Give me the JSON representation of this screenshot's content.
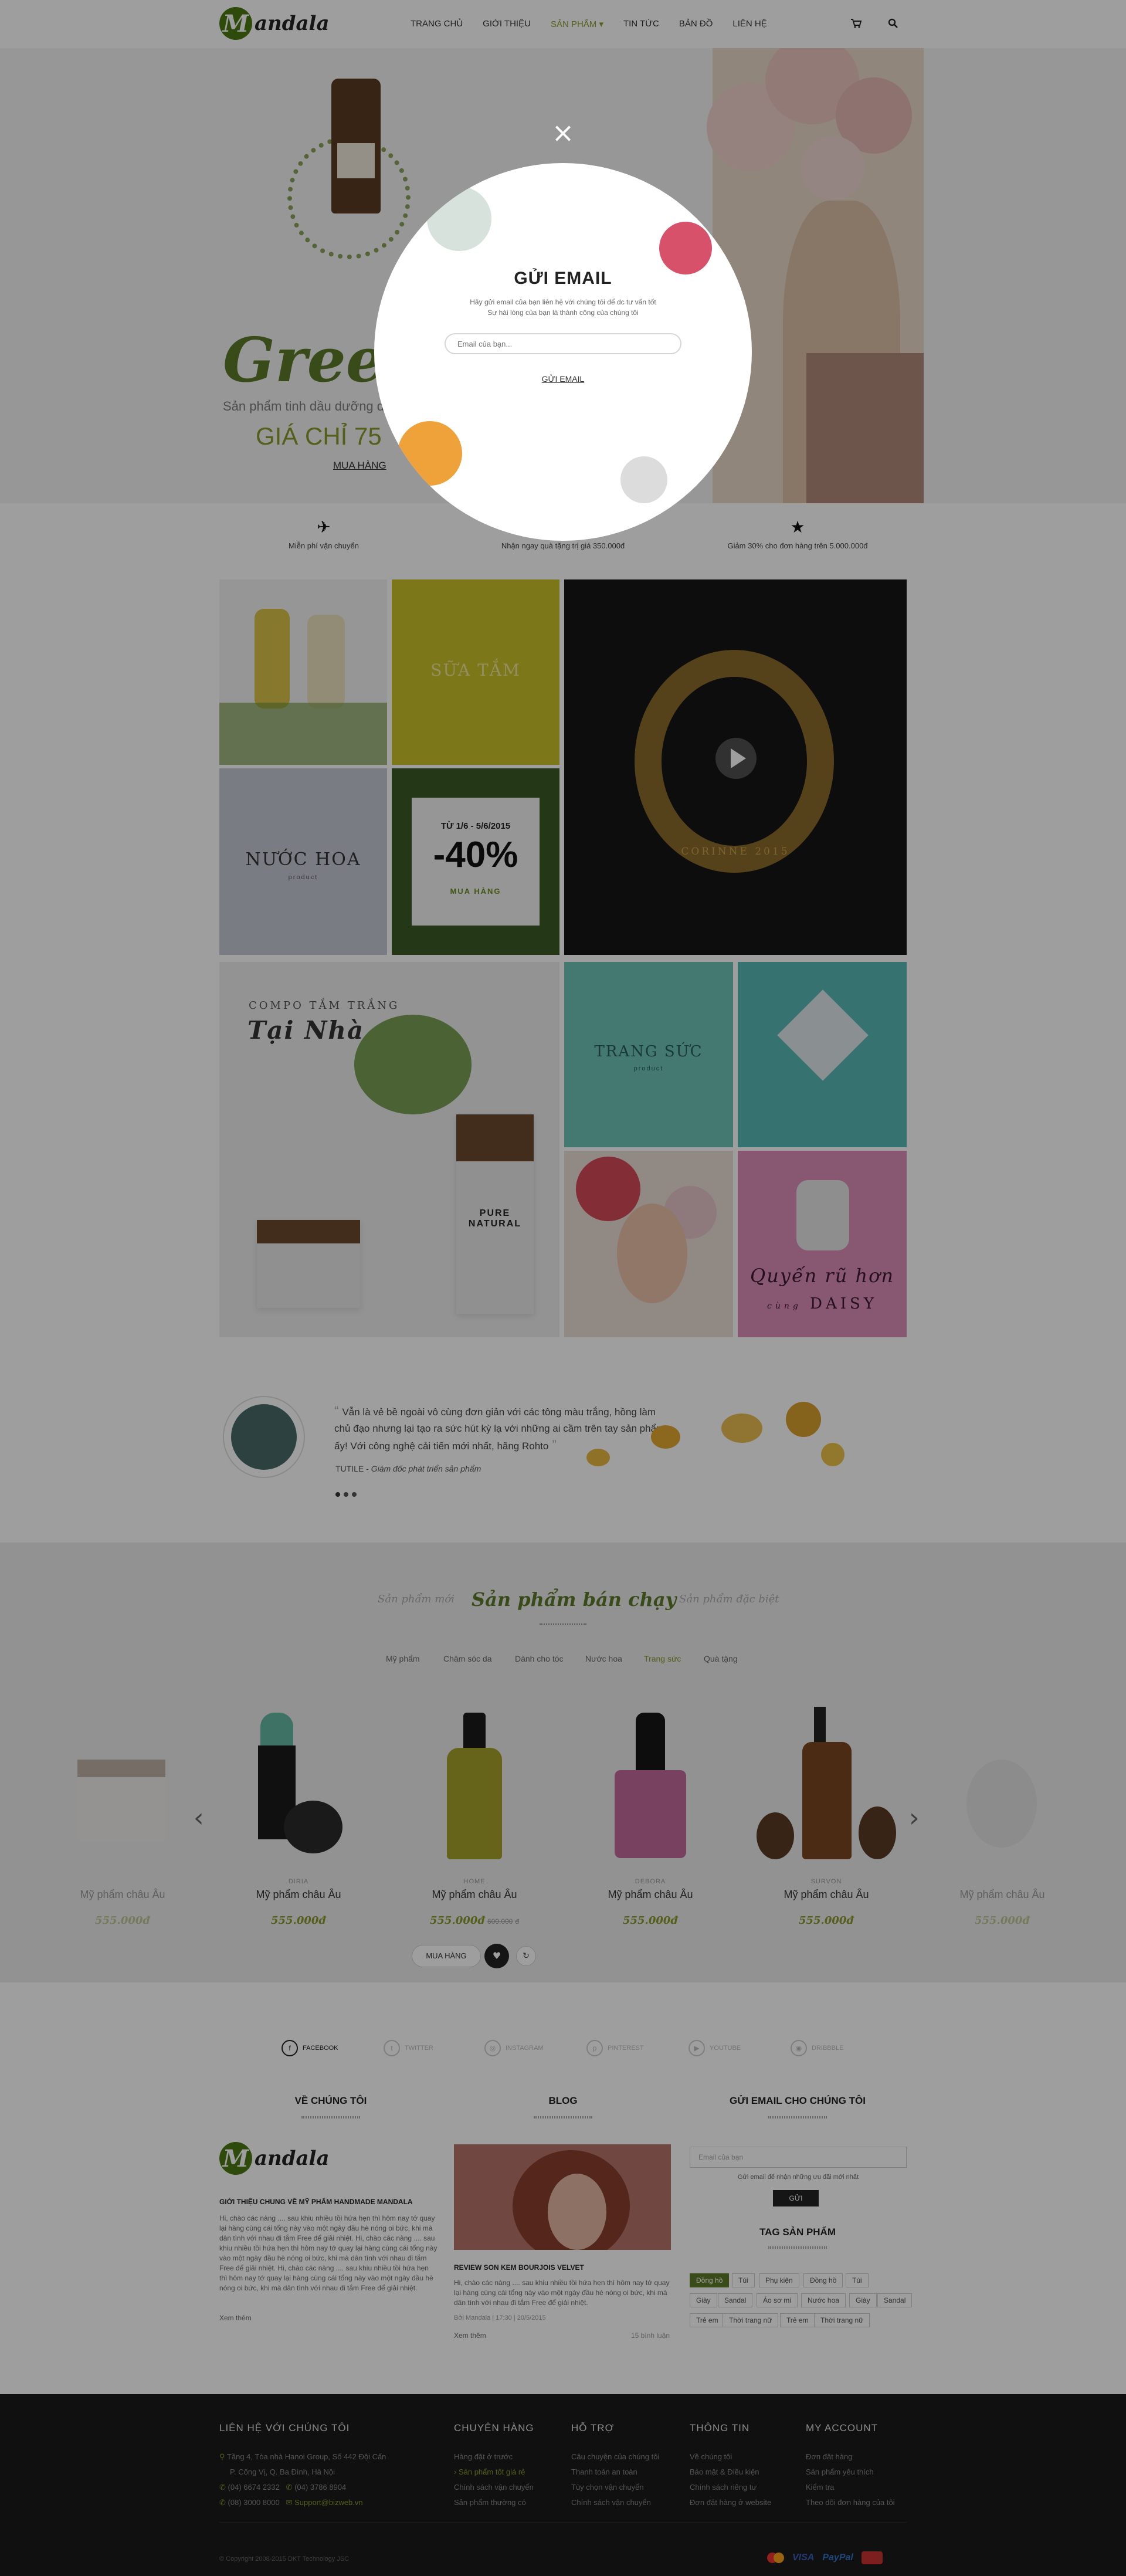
{
  "header": {
    "logo_letter": "M",
    "logo_text": "andala",
    "nav": [
      "TRANG CHỦ",
      "GIỚI THIỆU",
      "SẢN PHẨM",
      "TIN TỨC",
      "BẢN ĐỒ",
      "LIÊN HỆ"
    ],
    "nav_active_index": 2,
    "cart_icon": "cart-icon",
    "search_icon": "search-icon"
  },
  "hero": {
    "title": "Green",
    "subtitle": "Sản phẩm tinh dầu dưỡng da",
    "price": "GIÁ CHỈ 75",
    "cta": "MUA HÀNG"
  },
  "modal": {
    "close": "×",
    "title": "GỬI EMAIL",
    "desc_line1": "Hãy gửi email của bạn liên hệ với chúng tôi để dc tư vấn tốt",
    "desc_line2": "Sự hài lòng của bạn là thành công của chúng tôi",
    "input_placeholder": "Email của bạn...",
    "button": "GỬI EMAIL"
  },
  "features": [
    {
      "icon": "plane-icon",
      "text": "Miễn phí vận chuyển"
    },
    {
      "icon": "gift-icon",
      "text": "Nhận ngay quà tặng trị giá 350.000đ"
    },
    {
      "icon": "star-icon",
      "text": "Giảm 30% cho đơn hàng trên 5.000.000đ"
    }
  ],
  "grid": {
    "sua_tam": "SỮA TẮM",
    "nuoc_hoa": "NƯỚC HOA",
    "nuoc_hoa_sub": "product",
    "promo_date": "TỪ 1/6 - 5/6/2015",
    "promo_pct": "-40%",
    "promo_cta": "MUA HÀNG",
    "bracelet": "CORINNE 2015",
    "combo_line1": "COMPO TẮM TRẮNG",
    "combo_line2": "Tại Nhà",
    "pure_natural": "PURE NATURAL",
    "trang_suc": "TRANG SỨC",
    "trang_suc_sub": "product",
    "quyen_ru_1": "Quyến rũ hơn",
    "quyen_ru_2": "cùng",
    "quyen_ru_3": "DAISY"
  },
  "testimonial": {
    "quote": "Vẫn là vẻ bề ngoài vô cùng đơn giản với các tông màu trắng, hồng làm chủ đạo nhưng lại tạo ra sức hút kỳ lạ với những ai cầm trên tay sản phẩm ấy! Với công nghệ cải tiến mới nhất, hãng Rohto",
    "author": "TUTILE",
    "role": "Giám đốc phát triển sản phẩm"
  },
  "products_section": {
    "tabs": [
      "Sản phẩm mới",
      "Sản phẩm bán chạy",
      "Sản phẩm đặc biệt"
    ],
    "active_tab": 1,
    "categories": [
      "Mỹ phẩm",
      "Chăm sóc da",
      "Dành cho tóc",
      "Nước hoa",
      "Trang sức",
      "Quà tặng"
    ],
    "active_category": 4,
    "items": [
      {
        "brand": "",
        "name": "Mỹ phẩm châu Âu",
        "price": "555.000",
        "old": ""
      },
      {
        "brand": "DIRIA",
        "name": "Mỹ phẩm châu Âu",
        "price": "555.000",
        "old": ""
      },
      {
        "brand": "HOME",
        "name": "Mỹ phẩm châu Âu",
        "price": "555.000",
        "old": "600.000"
      },
      {
        "brand": "DEBORA",
        "name": "Mỹ phẩm châu Âu",
        "price": "555.000",
        "old": ""
      },
      {
        "brand": "SURVON",
        "name": "Mỹ phẩm châu Âu",
        "price": "555.000",
        "old": ""
      },
      {
        "brand": "",
        "name": "Mỹ phẩm châu Âu",
        "price": "555.000",
        "old": ""
      }
    ],
    "currency": "đ",
    "buy_button": "MUA HÀNG"
  },
  "social": [
    "FACEBOOK",
    "TWITTER",
    "INSTAGRAM",
    "PINTEREST",
    "YOUTUBE",
    "DRIBBBLE"
  ],
  "about": {
    "heading": "VỀ CHÚNG TÔI",
    "logo_letter": "M",
    "logo_text": "andala",
    "subtitle": "GIỚI THIỆU CHUNG VỀ MỸ PHẨM HANDMADE MANDALA",
    "body": "Hi, chào các nàng .... sau khiu nhiều tồi hứa hẹn thì hôm nay tớ quay lại hàng cùng cái tổng này vào một ngày đầu hè nóng oi bức, khi mà dân tình với nhau đi tắm Free để giải nhiệt. Hi, chào các nàng .... sau khiu nhiều tồi hứa hẹn thì hôm nay tớ quay lại hàng cùng cái tổng này vào một ngày đầu hè nóng oi bức, khi mà dân tình với nhau đi tắm Free để giải nhiệt. Hi, chào các nàng .... sau khiu nhiều tồi hứa hẹn thì hôm nay tớ quay lại hàng cùng cái tổng này vào một ngày đầu hè nóng oi bức, khi mà dân tình với nhau đi tắm Free để giải nhiệt.",
    "more": "Xem thêm"
  },
  "blog": {
    "heading": "BLOG",
    "post_title": "REVIEW SON KEM BOURJOIS VELVET",
    "excerpt": "Hi, chào các nàng .... sau khiu nhiều tồi hứa hẹn thì hôm nay tớ quay lại hàng cùng cái tổng này vào một ngày đầu hè nóng oi bức, khi mà dân tình với nhau đi tắm Free để giải nhiệt.",
    "meta": "Bởi Mandala | 17:30 | 20/5/2015",
    "more": "Xem thêm",
    "comments": "15 bình luận"
  },
  "newsletter": {
    "heading": "GỬI EMAIL CHO CHÚNG TÔI",
    "placeholder": "Email của bạn",
    "note": "Gửi email để nhận những ưu đãi mới nhất",
    "button": "GỬI"
  },
  "tags": {
    "heading": "TAG SẢN PHẨM",
    "items": [
      "Đồng hồ",
      "Túi",
      "Phụ kiện",
      "Đồng hồ",
      "Túi",
      "Giày",
      "Sandal",
      "Áo sơ mi",
      "Nước hoa",
      "Giày",
      "Sandal",
      "Trẻ em",
      "Thời trang nữ",
      "Trẻ em",
      "Thời trang nữ"
    ],
    "active_index": 0
  },
  "footer": {
    "contact": {
      "heading": "LIÊN HỆ VỚI CHÚNG TÔI",
      "address": "Tầng 4, Tòa nhà Hanoi Group, Số 442 Đội Cấn",
      "district": "P. Cống Vị, Q. Ba Đình, Hà Nội",
      "phone1": "(04) 6674 2332",
      "phone2": "(04) 3786 8904",
      "hotline": "(08) 3000 8000",
      "email": "Support@bizweb.vn"
    },
    "columns": [
      {
        "heading": "CHUYÊN HÀNG",
        "items": [
          "Hàng đặt ở trước",
          "Sản phẩm tốt giá rẻ",
          "Chính sách vận chuyển",
          "Sản phẩm thường có"
        ]
      },
      {
        "heading": "HỖ TRỢ",
        "items": [
          "Câu chuyện của chúng tôi",
          "Thanh toán an toàn",
          "Tùy chọn vận chuyển",
          "Chính sách vận chuyển"
        ]
      },
      {
        "heading": "THÔNG TIN",
        "items": [
          "Về chúng tôi",
          "Bảo mật & Điều kiện",
          "Chính sách riêng tư",
          "Đơn đặt hàng ở website"
        ]
      },
      {
        "heading": "MY ACCOUNT",
        "items": [
          "Đơn đặt hàng",
          "Sản phẩm yêu thích",
          "Kiểm tra",
          "Theo dõi đơn hàng của tôi"
        ]
      }
    ],
    "copyright": "© Copyright 2008-2015 DKT Technology JSC",
    "payments": [
      "mastercard-icon",
      "visa-icon",
      "paypal-icon",
      "card-icon"
    ],
    "visa": "VISA",
    "paypal": "PayPal"
  }
}
